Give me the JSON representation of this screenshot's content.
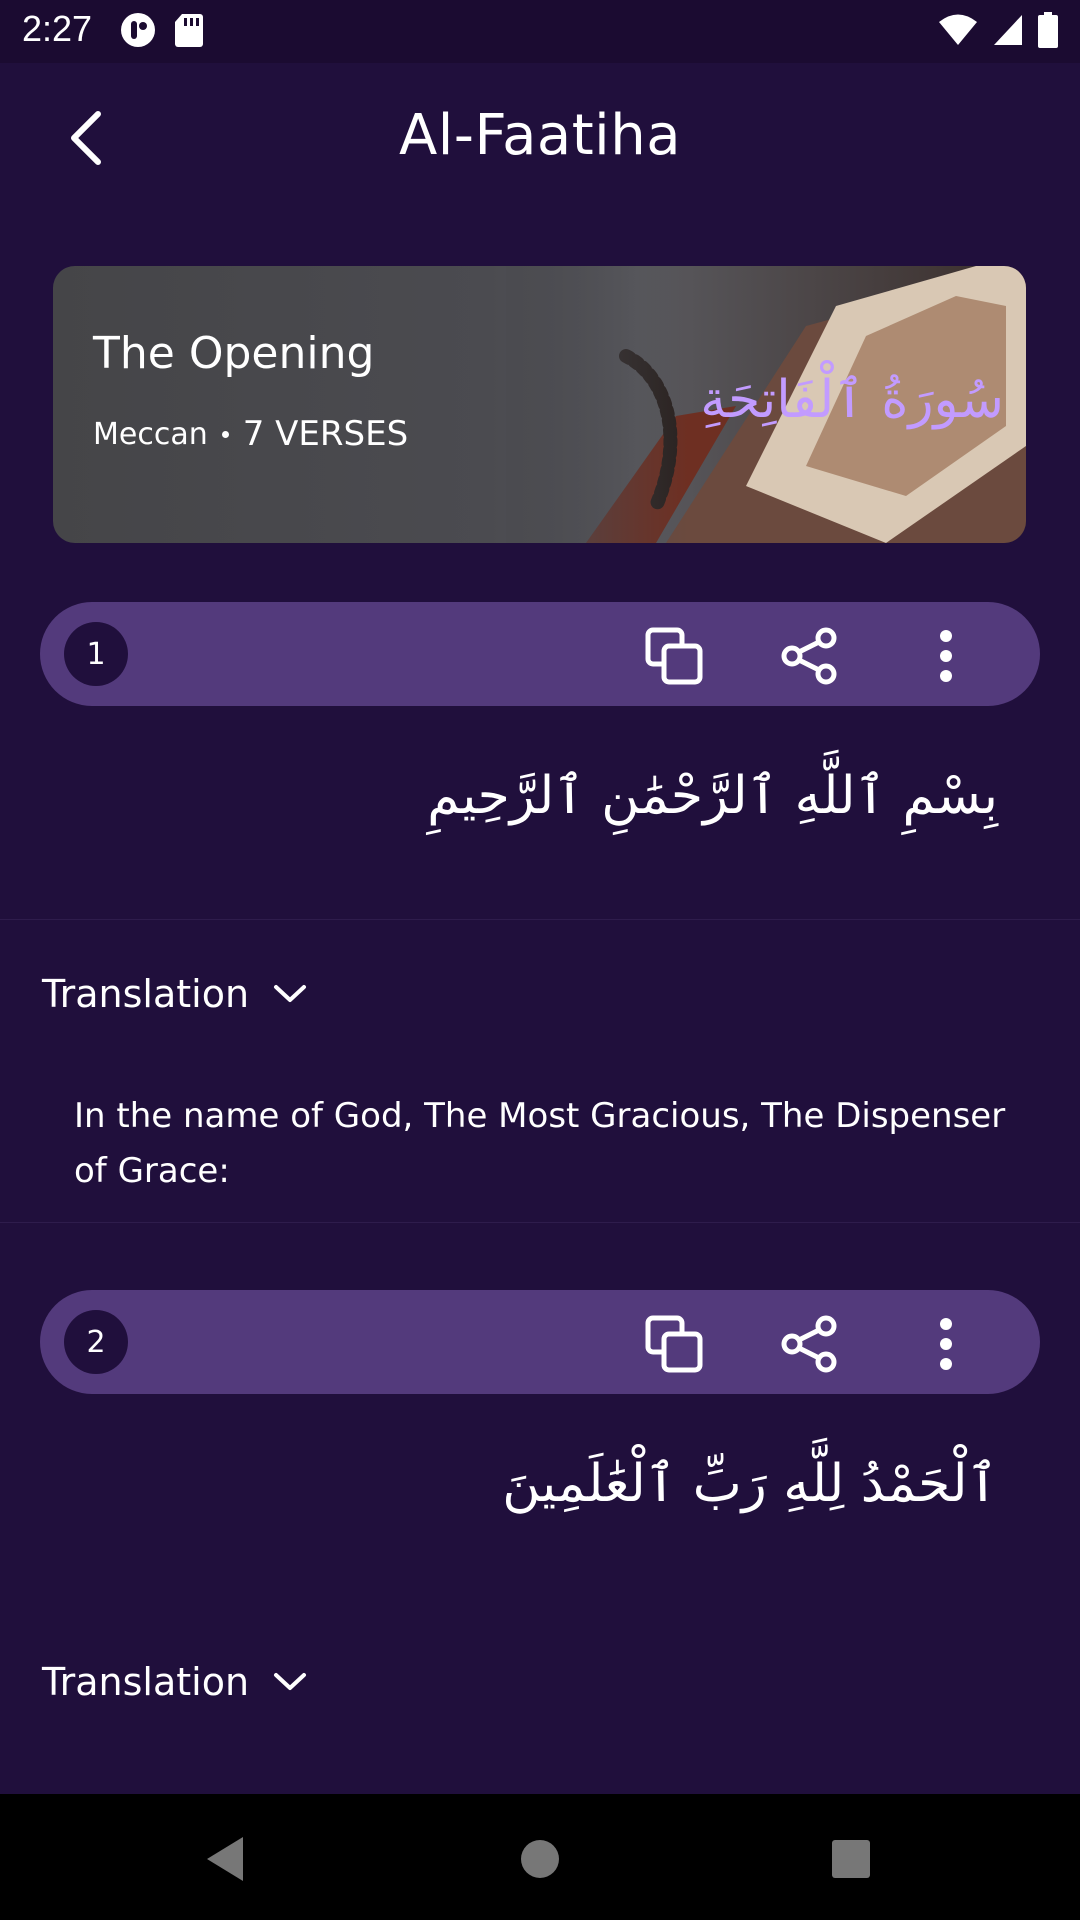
{
  "status_bar": {
    "time": "2:27",
    "icons": [
      "app-icon",
      "sd-card-icon",
      "wifi-icon",
      "signal-icon",
      "battery-icon"
    ]
  },
  "app_bar": {
    "title": "Al-Faatiha",
    "back_icon": "chevron-left-icon"
  },
  "surah_header": {
    "english_name": "The Opening",
    "revelation_place": "Meccan",
    "verse_count": "7 VERSES",
    "arabic_name": "سُورَةُ ٱلْفَاتِحَةِ",
    "arabic_name_color": "#c29bff"
  },
  "verses": [
    {
      "number": "1",
      "arabic": "بِسْمِ ٱللَّهِ ٱلرَّحْمَٰنِ ٱلرَّحِيمِ",
      "translation_label": "Translation",
      "translation_text": "In the name of God, The Most Gracious, The Dispenser of Grace:",
      "translation_expanded": true
    },
    {
      "number": "2",
      "arabic": "ٱلْحَمْدُ لِلَّهِ رَبِّ ٱلْعَٰلَمِينَ",
      "translation_label": "Translation",
      "translation_expanded": false
    }
  ],
  "verse_actions": [
    "copy-icon",
    "share-icon",
    "more-vertical-icon"
  ],
  "nav_bar": [
    "back-triangle-icon",
    "home-circle-icon",
    "recents-square-icon"
  ],
  "colors": {
    "background": "#200f3c",
    "verse_bar": "#533a7c",
    "accent": "#c29bff"
  }
}
